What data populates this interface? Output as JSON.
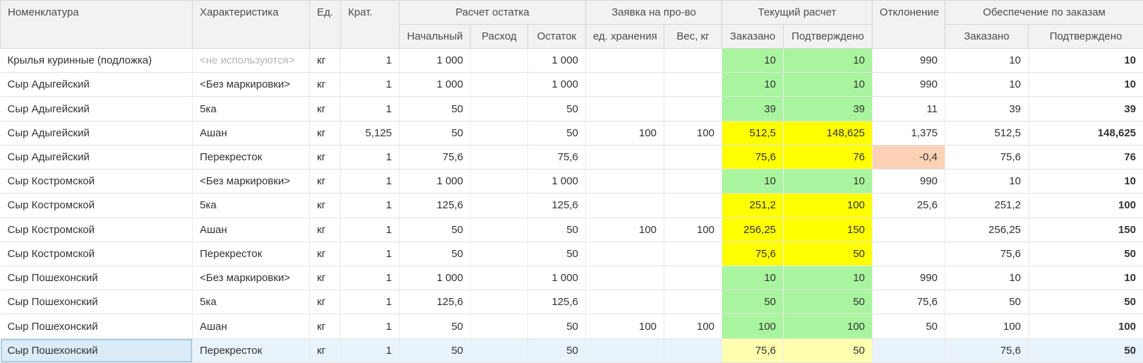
{
  "table": {
    "headers": {
      "nomenclature": "Номенклатура",
      "characteristic": "Характеристика",
      "unit": "Ед.",
      "multiplicity": "Крат.",
      "balance_group": "Расчет остатка",
      "initial": "Начальный",
      "expense": "Расход",
      "remainder": "Остаток",
      "production_group": "Заявка на про-во",
      "storage_units": "ед. хранения",
      "weight": "Вес, кг",
      "current_group": "Текущий расчет",
      "ordered": "Заказано",
      "confirmed": "Подтверждено",
      "deviation": "Отклонение",
      "supply_group": "Обеспечение по заказам",
      "supply_ordered": "Заказано",
      "supply_confirmed": "Подтверждено"
    },
    "rows": [
      {
        "name": "Крылья куринные (подложка)",
        "char": "<не используются>",
        "char_muted": true,
        "unit": "кг",
        "mult": "1",
        "initial": "1 000",
        "expense": "",
        "remainder": "1 000",
        "storage": "",
        "weight": "",
        "ordered": "10",
        "confirmed": "10",
        "hl": "g",
        "deviation": "990",
        "dev_neg": false,
        "sup_ordered": "10",
        "sup_confirmed": "10"
      },
      {
        "name": "Сыр Адыгейский",
        "char": "<Без маркировки>",
        "char_muted": false,
        "unit": "кг",
        "mult": "1",
        "initial": "1 000",
        "expense": "",
        "remainder": "1 000",
        "storage": "",
        "weight": "",
        "ordered": "10",
        "confirmed": "10",
        "hl": "g",
        "deviation": "990",
        "dev_neg": false,
        "sup_ordered": "10",
        "sup_confirmed": "10"
      },
      {
        "name": "Сыр Адыгейский",
        "char": "5ка",
        "char_muted": false,
        "unit": "кг",
        "mult": "1",
        "initial": "50",
        "expense": "",
        "remainder": "50",
        "storage": "",
        "weight": "",
        "ordered": "39",
        "confirmed": "39",
        "hl": "g",
        "deviation": "11",
        "dev_neg": false,
        "sup_ordered": "39",
        "sup_confirmed": "39"
      },
      {
        "name": "Сыр Адыгейский",
        "char": "Ашан",
        "char_muted": false,
        "unit": "кг",
        "mult": "5,125",
        "initial": "50",
        "expense": "",
        "remainder": "50",
        "storage": "100",
        "weight": "100",
        "ordered": "512,5",
        "confirmed": "148,625",
        "hl": "y",
        "deviation": "1,375",
        "dev_neg": false,
        "sup_ordered": "512,5",
        "sup_confirmed": "148,625"
      },
      {
        "name": "Сыр Адыгейский",
        "char": "Перекресток",
        "char_muted": false,
        "unit": "кг",
        "mult": "1",
        "initial": "75,6",
        "expense": "",
        "remainder": "75,6",
        "storage": "",
        "weight": "",
        "ordered": "75,6",
        "confirmed": "76",
        "hl": "y",
        "deviation": "-0,4",
        "dev_neg": true,
        "sup_ordered": "75,6",
        "sup_confirmed": "76"
      },
      {
        "name": "Сыр Костромской",
        "char": "<Без маркировки>",
        "char_muted": false,
        "unit": "кг",
        "mult": "1",
        "initial": "1 000",
        "expense": "",
        "remainder": "1 000",
        "storage": "",
        "weight": "",
        "ordered": "10",
        "confirmed": "10",
        "hl": "g",
        "deviation": "990",
        "dev_neg": false,
        "sup_ordered": "10",
        "sup_confirmed": "10"
      },
      {
        "name": "Сыр Костромской",
        "char": "5ка",
        "char_muted": false,
        "unit": "кг",
        "mult": "1",
        "initial": "125,6",
        "expense": "",
        "remainder": "125,6",
        "storage": "",
        "weight": "",
        "ordered": "251,2",
        "confirmed": "100",
        "hl": "y",
        "deviation": "25,6",
        "dev_neg": false,
        "sup_ordered": "251,2",
        "sup_confirmed": "100"
      },
      {
        "name": "Сыр Костромской",
        "char": "Ашан",
        "char_muted": false,
        "unit": "кг",
        "mult": "1",
        "initial": "50",
        "expense": "",
        "remainder": "50",
        "storage": "100",
        "weight": "100",
        "ordered": "256,25",
        "confirmed": "150",
        "hl": "y",
        "deviation": "",
        "dev_neg": false,
        "sup_ordered": "256,25",
        "sup_confirmed": "150"
      },
      {
        "name": "Сыр Костромской",
        "char": "Перекресток",
        "char_muted": false,
        "unit": "кг",
        "mult": "1",
        "initial": "50",
        "expense": "",
        "remainder": "50",
        "storage": "",
        "weight": "",
        "ordered": "75,6",
        "confirmed": "50",
        "hl": "y",
        "deviation": "",
        "dev_neg": false,
        "sup_ordered": "75,6",
        "sup_confirmed": "50"
      },
      {
        "name": "Сыр Пошехонский",
        "char": "<Без маркировки>",
        "char_muted": false,
        "unit": "кг",
        "mult": "1",
        "initial": "1 000",
        "expense": "",
        "remainder": "1 000",
        "storage": "",
        "weight": "",
        "ordered": "10",
        "confirmed": "10",
        "hl": "g",
        "deviation": "990",
        "dev_neg": false,
        "sup_ordered": "10",
        "sup_confirmed": "10"
      },
      {
        "name": "Сыр Пошехонский",
        "char": "5ка",
        "char_muted": false,
        "unit": "кг",
        "mult": "1",
        "initial": "125,6",
        "expense": "",
        "remainder": "125,6",
        "storage": "",
        "weight": "",
        "ordered": "50",
        "confirmed": "50",
        "hl": "g",
        "deviation": "75,6",
        "dev_neg": false,
        "sup_ordered": "50",
        "sup_confirmed": "50"
      },
      {
        "name": "Сыр Пошехонский",
        "char": "Ашан",
        "char_muted": false,
        "unit": "кг",
        "mult": "1",
        "initial": "50",
        "expense": "",
        "remainder": "50",
        "storage": "100",
        "weight": "100",
        "ordered": "100",
        "confirmed": "100",
        "hl": "g",
        "deviation": "50",
        "dev_neg": false,
        "sup_ordered": "100",
        "sup_confirmed": "100"
      },
      {
        "name": "Сыр Пошехонский",
        "char": "Перекресток",
        "char_muted": false,
        "unit": "кг",
        "mult": "1",
        "initial": "50",
        "expense": "",
        "remainder": "50",
        "storage": "",
        "weight": "",
        "ordered": "75,6",
        "confirmed": "50",
        "hl": "y",
        "deviation": "",
        "dev_neg": false,
        "sup_ordered": "75,6",
        "sup_confirmed": "50",
        "selected": true
      }
    ]
  }
}
